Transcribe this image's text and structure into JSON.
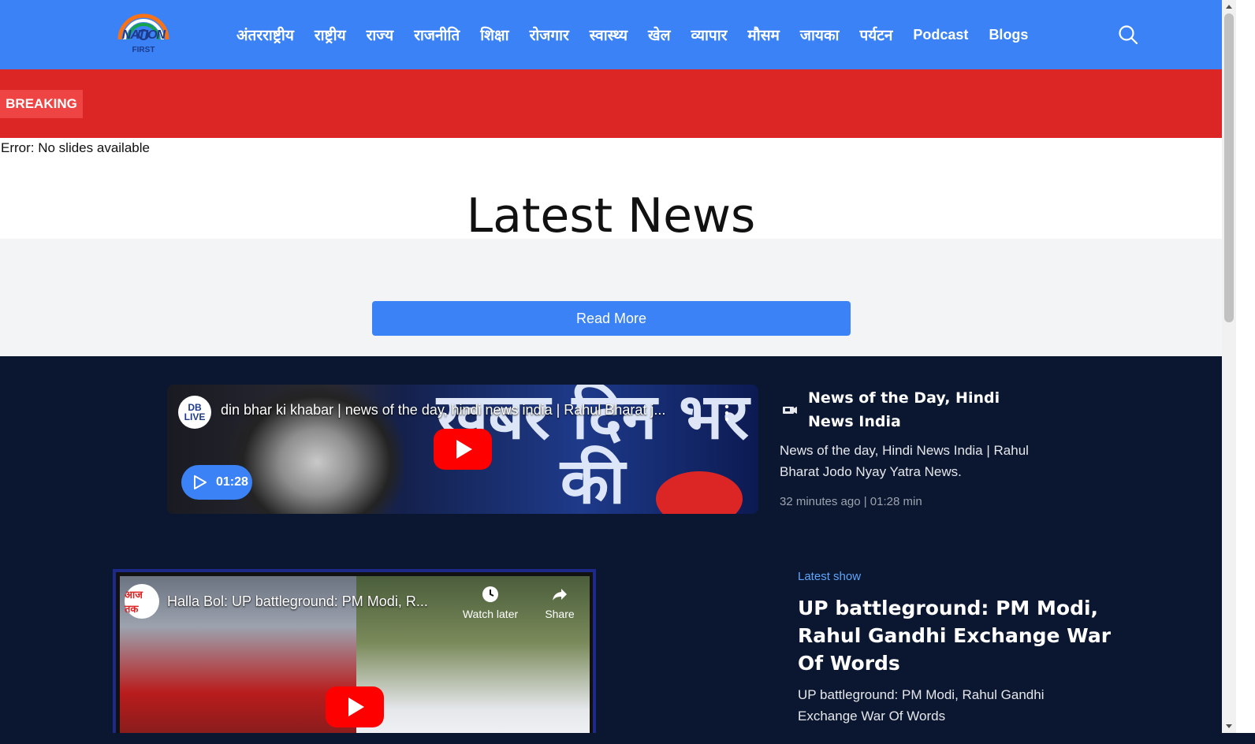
{
  "brand": {
    "logo_text": "NATION",
    "logo_sub": "FIRST"
  },
  "nav": {
    "items": [
      "अंतरराष्ट्रीय",
      "राष्ट्रीय",
      "राज्य",
      "राजनीति",
      "शिक्षा",
      "रोजगार",
      "स्वास्थ्य",
      "खेल",
      "व्यापार",
      "मौसम",
      "जायका",
      "पर्यटन",
      "Podcast",
      "Blogs"
    ],
    "search_icon": "search-icon"
  },
  "breaking": {
    "label": "BREAKING"
  },
  "slider": {
    "error": "Error: No slides available"
  },
  "latest": {
    "title": "Latest News",
    "read_more": "Read More"
  },
  "video1": {
    "channel_logo": "DB LIVE",
    "title": "din bhar ki khabar | news of the day, hindi news india | Rahul Bharat j...",
    "overlay_text": "ख़बर दिन भर की",
    "duration": "01:28"
  },
  "side1": {
    "title": "News of the Day, Hindi News India",
    "description": "News of the day, Hindi News India | Rahul Bharat Jodo Nyay Yatra News.",
    "meta": "32 minutes ago | 01:28 min"
  },
  "video2": {
    "channel_logo": "आज तक",
    "title": "Halla Bol: UP battleground: PM Modi, R...",
    "watch_later": "Watch later",
    "share": "Share"
  },
  "side2": {
    "label": "Latest show",
    "title": "UP battleground: PM Modi, Rahul Gandhi Exchange War Of Words",
    "description": "UP battleground: PM Modi, Rahul Gandhi Exchange War Of Words"
  },
  "colors": {
    "header": "#3b82f6",
    "breaking_bar": "#dc2626",
    "dark_section": "#0b1730",
    "accent_blue": "#3b82f6",
    "youtube_red": "#ff0000"
  }
}
